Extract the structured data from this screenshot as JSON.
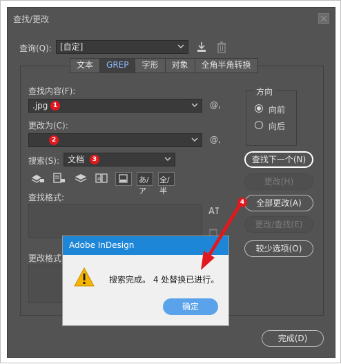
{
  "window": {
    "title": "查找/更改"
  },
  "query": {
    "label": "查询(Q):",
    "value": "[自定]"
  },
  "tabs": [
    {
      "label": "文本",
      "active": false
    },
    {
      "label": "GREP",
      "active": true
    },
    {
      "label": "字形",
      "active": false
    },
    {
      "label": "对象",
      "active": false
    },
    {
      "label": "全角半角转换",
      "active": false
    }
  ],
  "find": {
    "label": "查找内容(F):",
    "value": ".jpg",
    "badge": "1"
  },
  "change": {
    "label": "更改为(C):",
    "value": "",
    "badge": "2"
  },
  "search": {
    "label": "搜索(S):",
    "value": "文档",
    "badge": "3"
  },
  "at_symbol": "@,",
  "direction": {
    "title": "方向",
    "options": [
      {
        "label": "向前",
        "selected": true
      },
      {
        "label": "向后",
        "selected": false
      }
    ]
  },
  "buttons": {
    "find_next": "查找下一个(N)",
    "change": "更改(H)",
    "change_all": "全部更改(A)",
    "change_all_badge": "4",
    "change_find": "更改/查找(E)",
    "fewer_options": "较少选项(O)",
    "done": "完成(D)"
  },
  "option_icons": {
    "kana": "あ/ア",
    "width": "全/半"
  },
  "find_format": {
    "label": "查找格式:"
  },
  "change_format": {
    "label": "更改格式"
  },
  "alert": {
    "title": "Adobe InDesign",
    "message": "搜索完成。 4 处替换已进行。",
    "ok": "确定"
  },
  "colors": {
    "accent": "#1e86d6",
    "badge": "#e0191f",
    "dialog_bg": "#535353"
  }
}
